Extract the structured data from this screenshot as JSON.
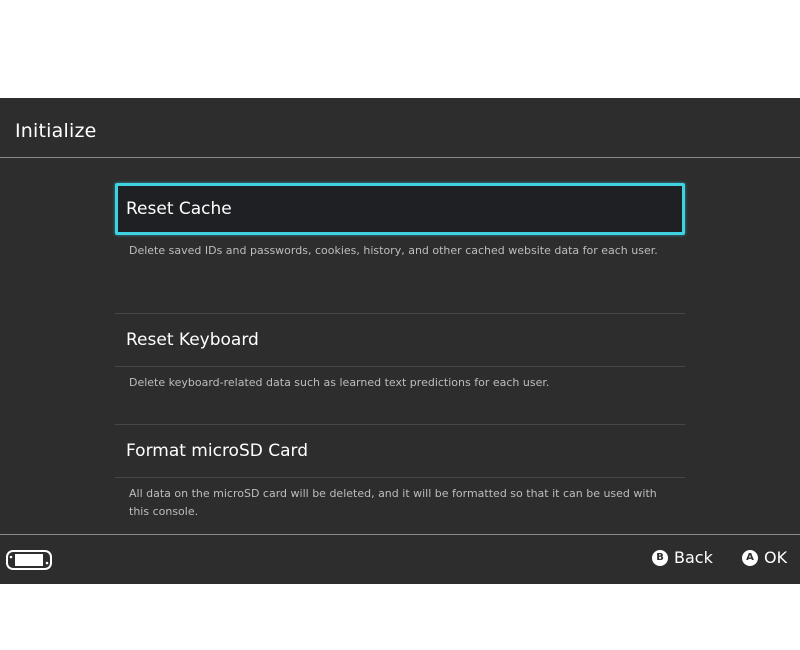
{
  "header": {
    "title": "Initialize"
  },
  "menu": {
    "items": [
      {
        "label": "Reset Cache",
        "description": "Delete saved IDs and passwords, cookies, history, and other cached website data for each user.",
        "selected": true
      },
      {
        "label": "Reset Keyboard",
        "description": "Delete keyboard-related data such as learned text predictions for each user.",
        "selected": false
      },
      {
        "label": "Format microSD Card",
        "description": "All data on the microSD card will be deleted, and it will be formatted so that it can be used with this console.",
        "selected": false
      }
    ]
  },
  "footer": {
    "console_icon": "handheld-console-icon",
    "back_glyph": "B",
    "back_label": "Back",
    "ok_glyph": "A",
    "ok_label": "OK"
  },
  "colors": {
    "background": "#2d2d2d",
    "selection_border": "#3fd3e1",
    "text": "#ffffff",
    "description_text": "#bdbdbd"
  }
}
